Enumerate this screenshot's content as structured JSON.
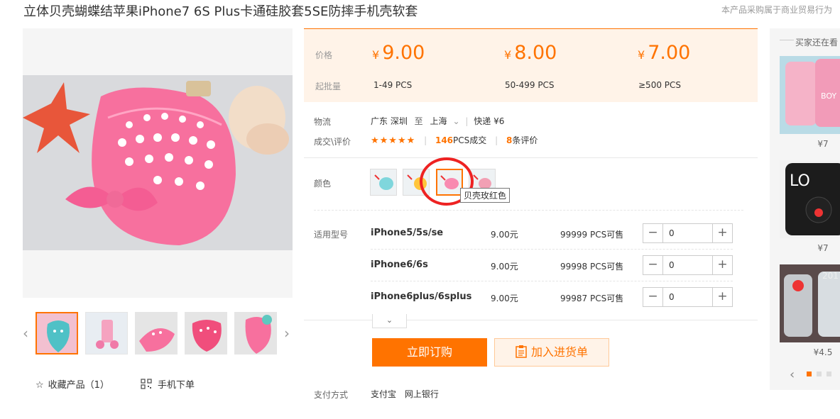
{
  "product": {
    "title": "立体贝壳蝴蝶结苹果iPhone7 6S Plus卡通硅胶套5SE防摔手机壳软套",
    "note": "本产品采购属于商业贸易行为"
  },
  "price_box": {
    "price_label": "价格",
    "moq_label": "起批量",
    "currency": "¥",
    "tiers": [
      {
        "price": "9.00",
        "range": "1-49  PCS"
      },
      {
        "price": "8.00",
        "range": "50-499  PCS"
      },
      {
        "price": "7.00",
        "range": "≥500  PCS"
      }
    ]
  },
  "logistics": {
    "label": "物流",
    "from": "广东 深圳",
    "to_word": "至",
    "to": "上海",
    "shipping": "快递 ¥6"
  },
  "deals": {
    "label": "成交\\评价",
    "stars": "★★★★★",
    "sold_count": "146",
    "sold_unit": "PCS成交",
    "review_count": "8",
    "review_unit": "条评价"
  },
  "color": {
    "label": "颜色",
    "tooltip": "贝壳玫红色"
  },
  "models": {
    "label": "适用型号",
    "rows": [
      {
        "name": "iPhone5/5s/se",
        "price": "9.00元",
        "stock": "99999 PCS可售",
        "qty": "0"
      },
      {
        "name": "iPhone6/6s",
        "price": "9.00元",
        "stock": "99998 PCS可售",
        "qty": "0"
      },
      {
        "name": "iPhone6plus/6splus",
        "price": "9.00元",
        "stock": "99987 PCS可售",
        "qty": "0"
      }
    ]
  },
  "actions": {
    "buy": "立即订购",
    "cart": "加入进货单",
    "favorite": "收藏产品（1）",
    "mobile_order": "手机下单"
  },
  "payment": {
    "label": "支付方式",
    "methods": [
      "支付宝",
      "网上银行"
    ]
  },
  "sidebar": {
    "title": "买家还在看",
    "items": [
      {
        "price": "¥7"
      },
      {
        "price": "¥7"
      },
      {
        "price": "¥4.5"
      }
    ],
    "accent": "#ff7300"
  },
  "colors": {
    "accent": "#ff7300",
    "price_bg": "#fff3e8",
    "annotation_circle": "#e22222"
  }
}
